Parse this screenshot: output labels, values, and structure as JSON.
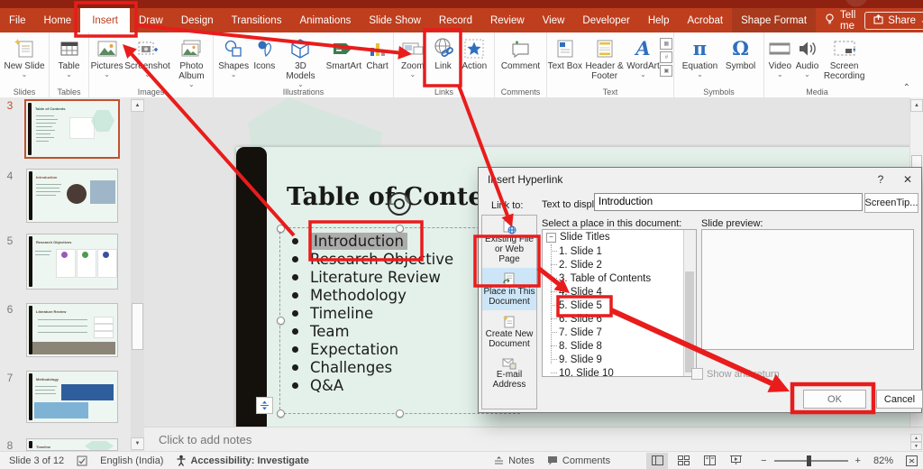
{
  "colors": {
    "annotation_red": "#E91C1C",
    "ribbon_red": "#BF3E1E",
    "contextual_tab_red": "#A8391C",
    "slide_mint": "#E3F1EA",
    "place_in_doc_selected_bg": "#CDE6F7",
    "selected_thumbnail_border": "#C0512E",
    "text_highlight_gray": "#ACACAC"
  },
  "glyphs": {
    "dropdown_chevron": "⌄",
    "collapse_ribbon": "⌃",
    "dialog_help": "?",
    "dialog_close": "✕",
    "tree_collapse": "−",
    "scroll_up": "▲",
    "scroll_down": "▼",
    "zoom_out": "−",
    "zoom_in": "+",
    "wordart": "A",
    "equation": "π",
    "symbol": "Ω"
  },
  "tabs": {
    "items": [
      "File",
      "Home",
      "Insert",
      "Draw",
      "Design",
      "Transitions",
      "Animations",
      "Slide Show",
      "Record",
      "Review",
      "View",
      "Developer",
      "Help",
      "Acrobat"
    ],
    "contextual": "Shape Format",
    "tell_me": "Tell me",
    "share": "Share"
  },
  "ribbon": {
    "buttons": {
      "new_slide": "New Slide",
      "table": "Table",
      "pictures": "Pictures",
      "screenshot": "Screenshot",
      "photo_album": "Photo Album",
      "shapes": "Shapes",
      "icons": "Icons",
      "models_3d": "3D Models",
      "smartart": "SmartArt",
      "chart": "Chart",
      "zoom": "Zoom",
      "link": "Link",
      "action": "Action",
      "comment": "Comment",
      "text_box": "Text Box",
      "header_footer": "Header & Footer",
      "wordart": "WordArt",
      "equation": "Equation",
      "symbol": "Symbol",
      "video": "Video",
      "audio": "Audio",
      "screen_recording": "Screen Recording"
    },
    "group_labels": {
      "slides": "Slides",
      "tables": "Tables",
      "images": "Images",
      "illustrations": "Illustrations",
      "links": "Links",
      "comments": "Comments",
      "text": "Text",
      "symbols": "Symbols",
      "media": "Media"
    }
  },
  "thumbnails": [
    {
      "number": "3",
      "title": "Table of Contents"
    },
    {
      "number": "4",
      "title": "Introduction"
    },
    {
      "number": "5",
      "title": "Research Objectives"
    },
    {
      "number": "6",
      "title": "Literature Review"
    },
    {
      "number": "7",
      "title": "Methodology"
    },
    {
      "number": "8",
      "title": "Timeline"
    }
  ],
  "slide": {
    "title": "Table of Contents",
    "bullets": [
      "Introduction",
      "Research Objective",
      "Literature Review",
      "Methodology",
      "Timeline",
      "Team",
      "Expectation",
      "Challenges",
      "Q&A"
    ]
  },
  "notes": {
    "placeholder": "Click to add notes"
  },
  "dialog": {
    "title": "Insert Hyperlink",
    "link_to_label": "Link to:",
    "text_to_display_label": "Text to display:",
    "text_to_display_value": "Introduction",
    "screentip_button": "ScreenTip...",
    "link_to_items": [
      "Existing File or Web Page",
      "Place in This Document",
      "Create New Document",
      "E-mail Address"
    ],
    "select_place_label": "Select a place in this document:",
    "tree_root": "Slide Titles",
    "tree_items": [
      "1. Slide 1",
      "2. Slide 2",
      "3. Table of Contents",
      "4. Slide 4",
      "5. Slide 5",
      "6. Slide 6",
      "7. Slide 7",
      "8. Slide 8",
      "9. Slide 9",
      "10. Slide 10"
    ],
    "slide_preview_label": "Slide preview:",
    "show_and_return_label": "Show and return",
    "ok_button": "OK",
    "cancel_button": "Cancel"
  },
  "status": {
    "slide_indicator": "Slide 3 of 12",
    "language": "English (India)",
    "accessibility": "Accessibility: Investigate",
    "notes_toggle": "Notes",
    "comments_toggle": "Comments",
    "zoom_level": "82%"
  }
}
